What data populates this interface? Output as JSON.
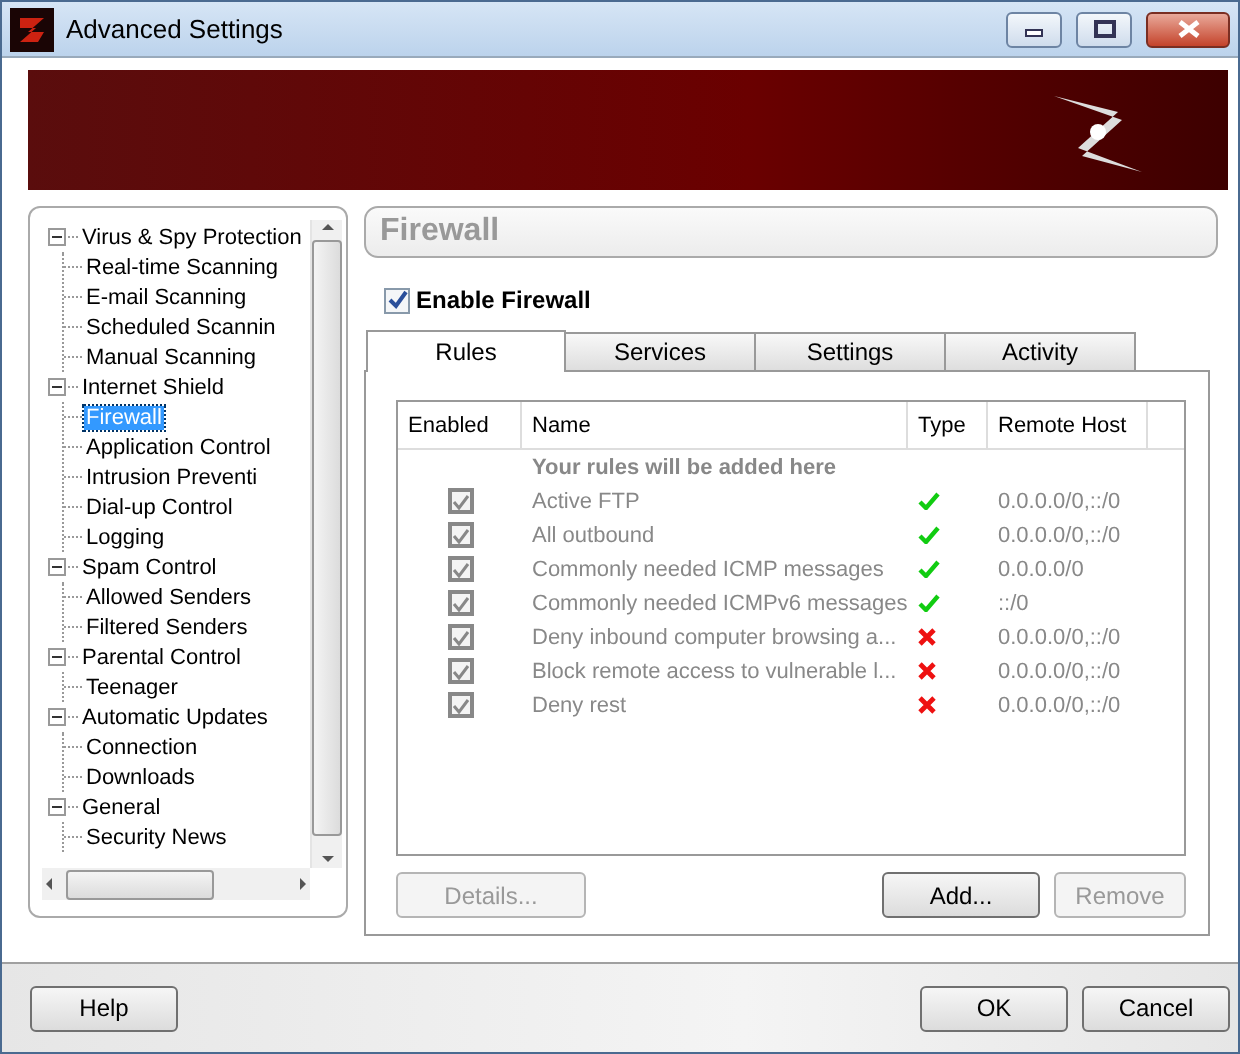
{
  "window": {
    "title": "Advanced Settings"
  },
  "tree": {
    "items": [
      {
        "label": "Virus & Spy Protection",
        "expanded": true,
        "selected": false,
        "children": [
          {
            "label": "Real-time Scanning",
            "selected": false
          },
          {
            "label": "E-mail Scanning",
            "selected": false
          },
          {
            "label": "Scheduled Scannin",
            "selected": false
          },
          {
            "label": "Manual Scanning",
            "selected": false
          }
        ]
      },
      {
        "label": "Internet Shield",
        "expanded": true,
        "selected": false,
        "children": [
          {
            "label": "Firewall",
            "selected": true
          },
          {
            "label": "Application Control",
            "selected": false
          },
          {
            "label": "Intrusion Preventi",
            "selected": false
          },
          {
            "label": "Dial-up Control",
            "selected": false
          },
          {
            "label": "Logging",
            "selected": false
          }
        ]
      },
      {
        "label": "Spam Control",
        "expanded": true,
        "selected": false,
        "children": [
          {
            "label": "Allowed Senders",
            "selected": false
          },
          {
            "label": "Filtered Senders",
            "selected": false
          }
        ]
      },
      {
        "label": "Parental Control",
        "expanded": true,
        "selected": false,
        "children": [
          {
            "label": "Teenager",
            "selected": false
          }
        ]
      },
      {
        "label": "Automatic Updates",
        "expanded": true,
        "selected": false,
        "children": [
          {
            "label": "Connection",
            "selected": false
          },
          {
            "label": "Downloads",
            "selected": false
          }
        ]
      },
      {
        "label": "General",
        "expanded": true,
        "selected": false,
        "children": [
          {
            "label": "Security News",
            "selected": false
          }
        ]
      }
    ]
  },
  "firewall": {
    "title": "Firewall",
    "enable": {
      "label": "Enable Firewall",
      "checked": true
    },
    "tabs": [
      {
        "label": "Rules",
        "selected": true
      },
      {
        "label": "Services",
        "selected": false
      },
      {
        "label": "Settings",
        "selected": false
      },
      {
        "label": "Activity",
        "selected": false
      }
    ],
    "table": {
      "columns": [
        "Enabled",
        "Name",
        "Type",
        "Remote Host"
      ],
      "hint": "Your rules will be added here",
      "rows": [
        {
          "enabled": true,
          "name": "Active FTP",
          "kind": "allow",
          "remote_host": "0.0.0.0/0,::/0"
        },
        {
          "enabled": true,
          "name": "All outbound",
          "kind": "allow",
          "remote_host": "0.0.0.0/0,::/0"
        },
        {
          "enabled": true,
          "name": "Commonly needed ICMP messages",
          "kind": "allow",
          "remote_host": "0.0.0.0/0"
        },
        {
          "enabled": true,
          "name": "Commonly needed ICMPv6 messages",
          "kind": "allow",
          "remote_host": "::/0"
        },
        {
          "enabled": true,
          "name": "Deny inbound computer browsing a...",
          "kind": "deny",
          "remote_host": "0.0.0.0/0,::/0"
        },
        {
          "enabled": true,
          "name": "Block remote access to vulnerable l...",
          "kind": "deny",
          "remote_host": "0.0.0.0/0,::/0"
        },
        {
          "enabled": true,
          "name": "Deny rest",
          "kind": "deny",
          "remote_host": "0.0.0.0/0,::/0"
        }
      ]
    },
    "buttons": [
      {
        "label": "Details...",
        "disabled": true
      },
      {
        "label": "Add...",
        "disabled": false
      },
      {
        "label": "Remove",
        "disabled": true
      }
    ]
  },
  "footer": {
    "left_buttons": [
      "Help"
    ],
    "right_buttons": [
      "OK",
      "Cancel"
    ]
  }
}
